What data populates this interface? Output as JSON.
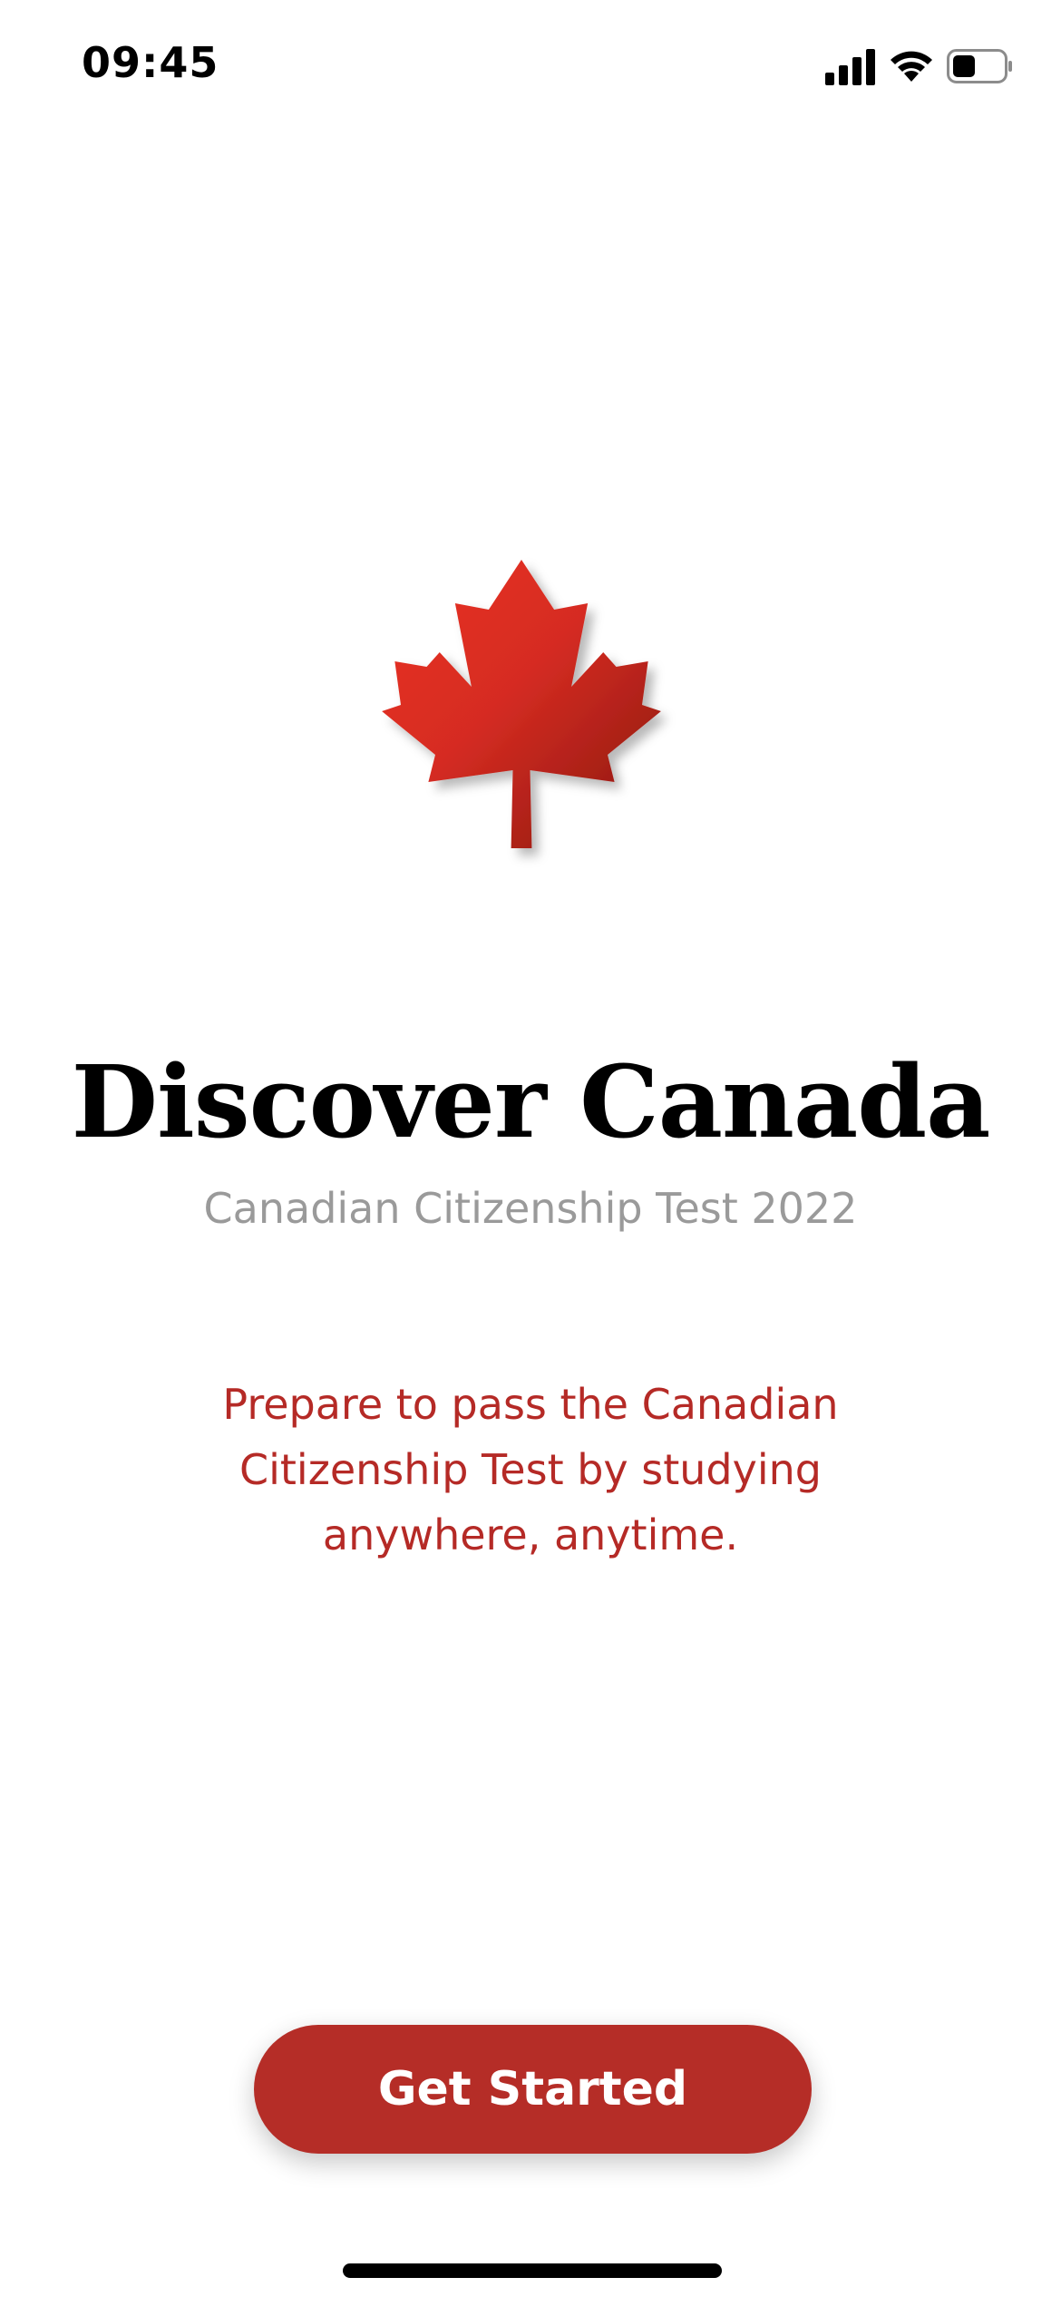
{
  "status_bar": {
    "time": "09:45",
    "icons": [
      "cellular-signal-icon",
      "wifi-icon",
      "battery-icon"
    ]
  },
  "logo": {
    "icon": "maple-leaf-icon",
    "colors": {
      "light": "#ea3226",
      "dark": "#8e1a12"
    }
  },
  "title": "Discover Canada",
  "subtitle": "Canadian Citizenship Test 2022",
  "description": "Prepare to pass the Canadian Citizenship Test by studying anywhere, anytime.",
  "cta": {
    "label": "Get Started",
    "color": "#b52d27"
  }
}
